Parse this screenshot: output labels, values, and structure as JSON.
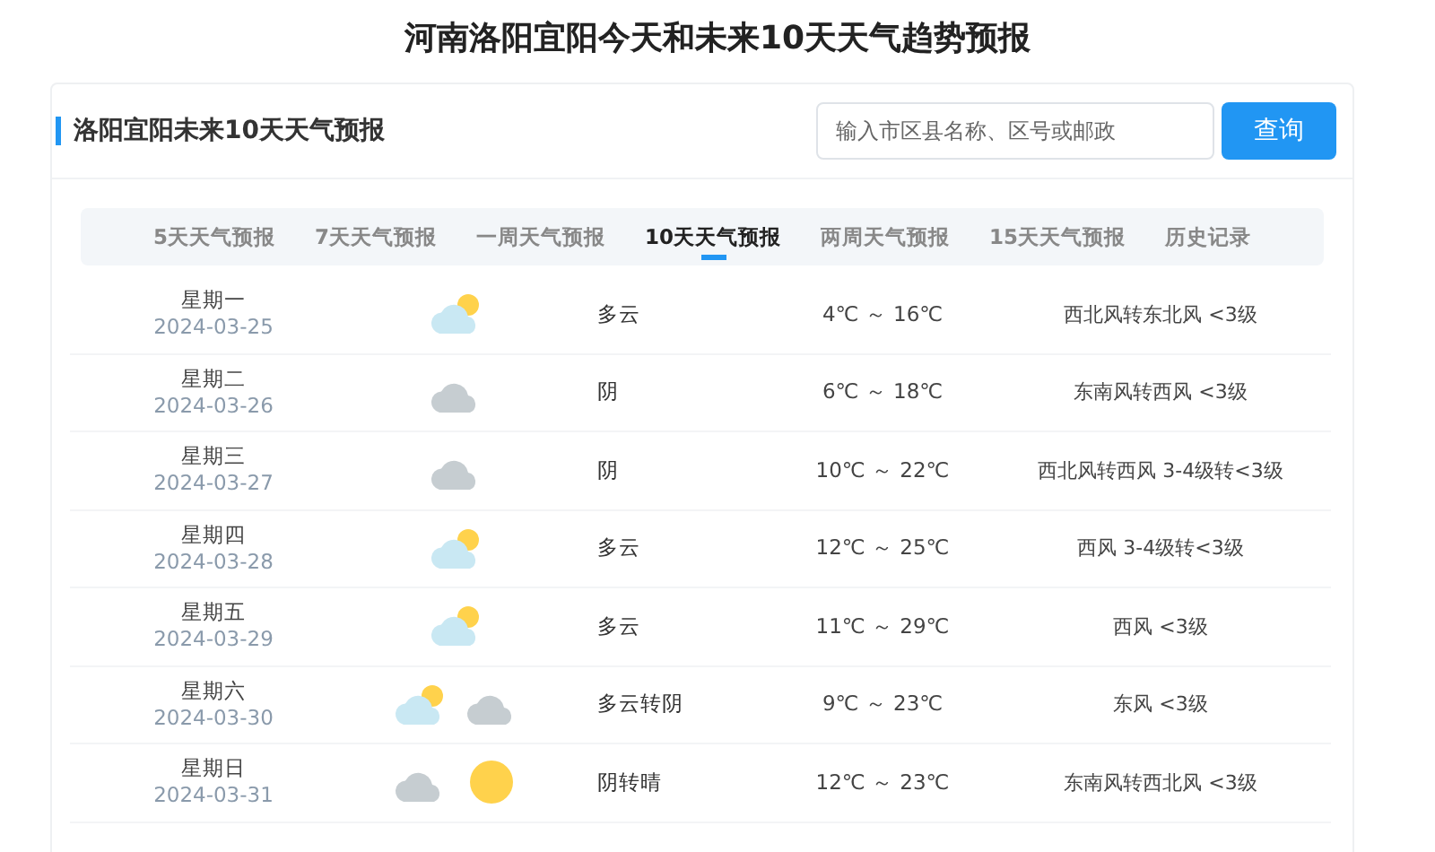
{
  "page_title": "河南洛阳宜阳今天和未来10天天气趋势预报",
  "card": {
    "title": "洛阳宜阳未来10天天气预报",
    "search": {
      "placeholder": "输入市区县名称、区号或邮政"
    },
    "search_button": "查询"
  },
  "tabs": [
    {
      "label": "5天天气预报",
      "selected": false
    },
    {
      "label": "7天天气预报",
      "selected": false
    },
    {
      "label": "一周天气预报",
      "selected": false
    },
    {
      "label": "10天天气预报",
      "selected": true
    },
    {
      "label": "两周天气预报",
      "selected": false
    },
    {
      "label": "15天天气预报",
      "selected": false
    },
    {
      "label": "历史记录",
      "selected": false
    }
  ],
  "forecast": [
    {
      "weekday": "星期一",
      "date": "2024-03-25",
      "icons": [
        {
          "kind": "partly-cloudy"
        }
      ],
      "weather": "多云",
      "temp": "4℃ ～ 16℃",
      "wind": "西北风转东北风 <3级"
    },
    {
      "weekday": "星期二",
      "date": "2024-03-26",
      "icons": [
        {
          "kind": "cloudy"
        }
      ],
      "weather": "阴",
      "temp": "6℃ ～ 18℃",
      "wind": "东南风转西风 <3级"
    },
    {
      "weekday": "星期三",
      "date": "2024-03-27",
      "icons": [
        {
          "kind": "cloudy"
        }
      ],
      "weather": "阴",
      "temp": "10℃ ～ 22℃",
      "wind": "西北风转西风 3-4级转<3级"
    },
    {
      "weekday": "星期四",
      "date": "2024-03-28",
      "icons": [
        {
          "kind": "partly-cloudy"
        }
      ],
      "weather": "多云",
      "temp": "12℃ ～ 25℃",
      "wind": "西风 3-4级转<3级"
    },
    {
      "weekday": "星期五",
      "date": "2024-03-29",
      "icons": [
        {
          "kind": "partly-cloudy"
        }
      ],
      "weather": "多云",
      "temp": "11℃ ～ 29℃",
      "wind": "西风 <3级"
    },
    {
      "weekday": "星期六",
      "date": "2024-03-30",
      "icons": [
        {
          "kind": "partly-cloudy"
        },
        {
          "kind": "cloudy"
        }
      ],
      "weather": "多云转阴",
      "temp": "9℃ ～ 23℃",
      "wind": "东风 <3级"
    },
    {
      "weekday": "星期日",
      "date": "2024-03-31",
      "icons": [
        {
          "kind": "cloudy"
        },
        {
          "kind": "sunny"
        }
      ],
      "weather": "阴转晴",
      "temp": "12℃ ～ 23℃",
      "wind": "东南风转西北风 <3级"
    }
  ]
}
